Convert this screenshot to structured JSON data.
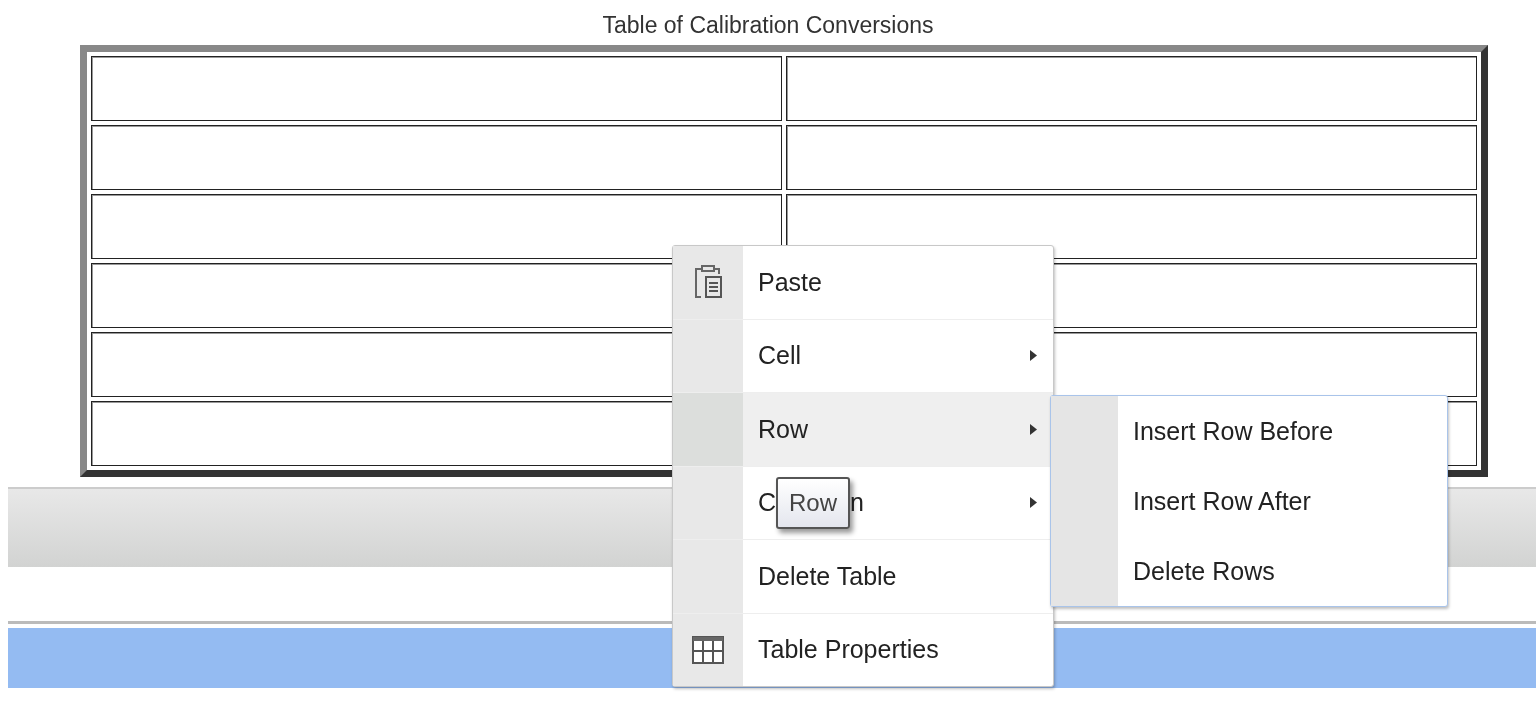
{
  "title": "Table of Calibration Conversions",
  "context_menu": {
    "items": [
      {
        "label": "Paste",
        "has_submenu": false,
        "selected": false
      },
      {
        "label": "Cell",
        "has_submenu": true,
        "selected": false
      },
      {
        "label": "Row",
        "has_submenu": true,
        "selected": true
      },
      {
        "label": "C",
        "label_tail": "n",
        "has_submenu": true,
        "selected": false
      },
      {
        "label": "Delete Table",
        "has_submenu": false,
        "selected": false
      },
      {
        "label": "Table Properties",
        "has_submenu": false,
        "selected": false
      }
    ]
  },
  "submenu": {
    "items": [
      {
        "label": "Insert Row Before"
      },
      {
        "label": "Insert Row After"
      },
      {
        "label": "Delete Rows"
      }
    ]
  },
  "tooltip": {
    "text": "Row"
  }
}
